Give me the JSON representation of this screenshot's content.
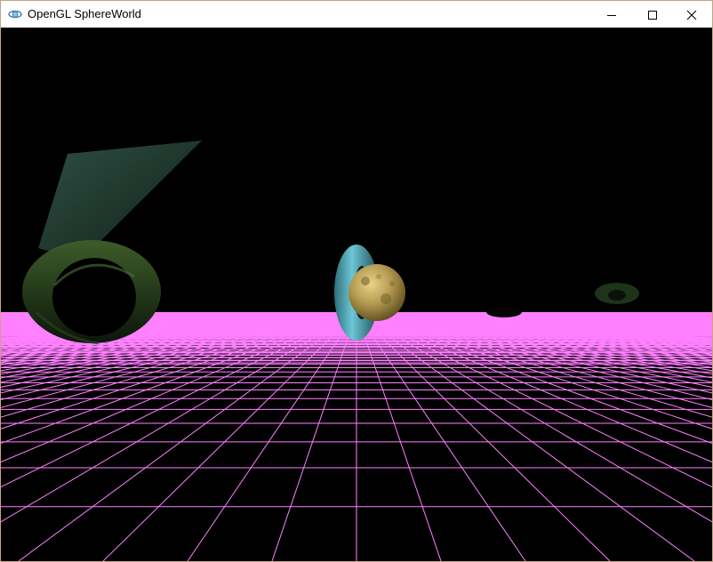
{
  "window": {
    "title": "OpenGL SphereWorld",
    "app_icon": "opengl-app-icon",
    "controls": [
      "minimize-icon",
      "maximize-icon",
      "close-icon"
    ]
  },
  "scene": {
    "background_color": "#000000",
    "floor_grid_color": "#ff80ff",
    "objects": [
      "torus",
      "sphere",
      "floor-grid"
    ]
  }
}
